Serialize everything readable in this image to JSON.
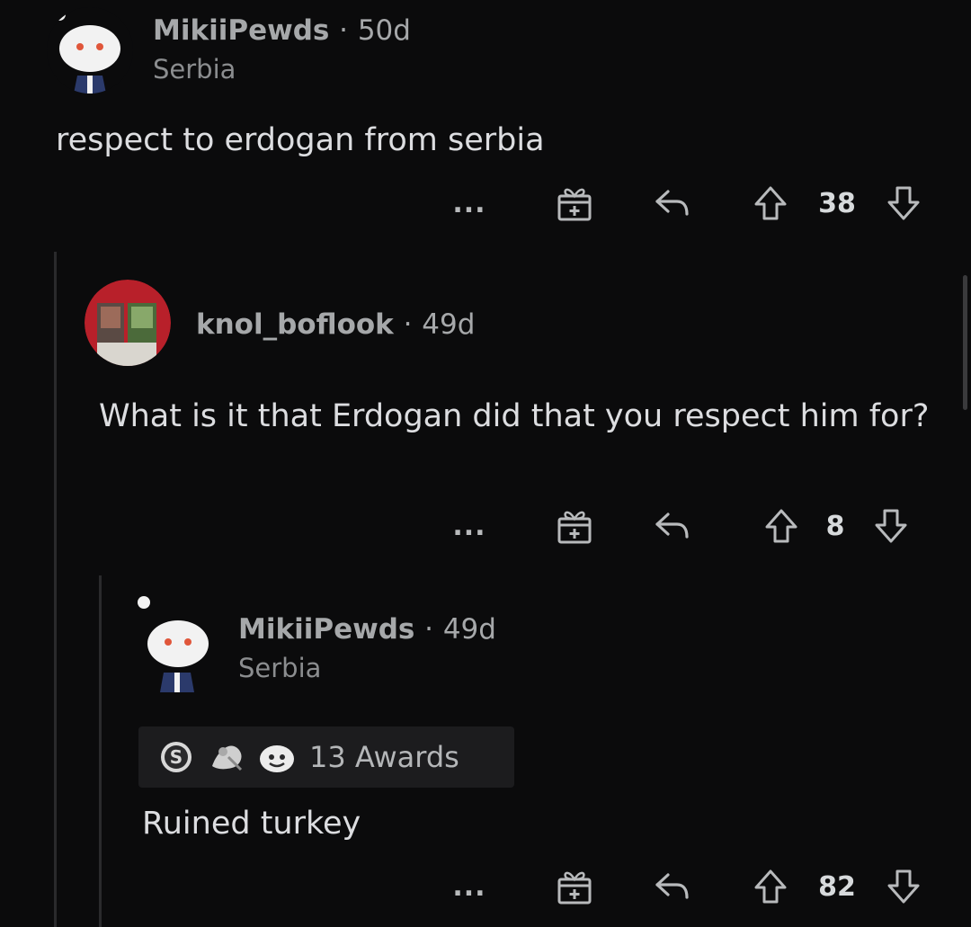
{
  "comments": [
    {
      "username": "MikiiPewds",
      "age": "50d",
      "flair": "Serbia",
      "body": "respect to erdogan from serbia",
      "score": "38",
      "more_label": "..."
    },
    {
      "username": "knol_boflook",
      "age": "49d",
      "body": "What is it that Erdogan did that you respect him for?",
      "score": "8",
      "more_label": "..."
    },
    {
      "username": "MikiiPewds",
      "age": "49d",
      "flair": "Serbia",
      "awards": "13 Awards",
      "body": "Ruined turkey",
      "score": "82",
      "more_label": "..."
    }
  ],
  "separator": "·",
  "colors": {
    "background": "#0b0b0c",
    "text": "#dcdde0",
    "meta": "#a6a8aa",
    "thread_line": "#2a2a2c"
  }
}
